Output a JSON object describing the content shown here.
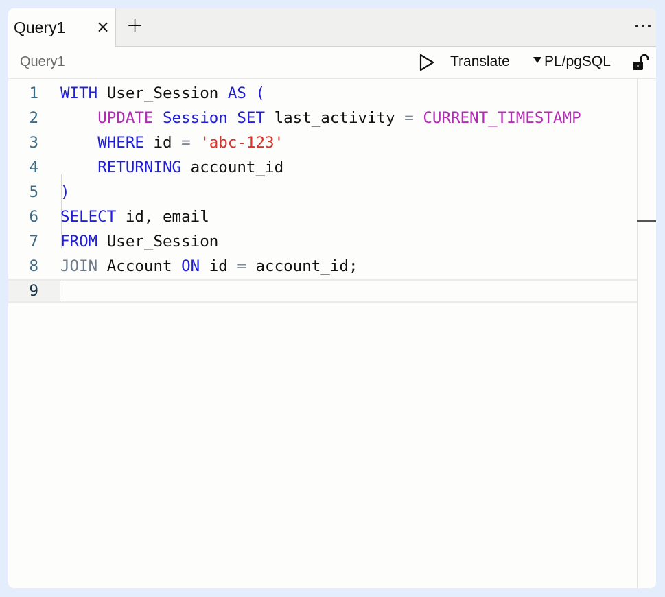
{
  "tabs": [
    {
      "label": "Query1",
      "active": true,
      "close_glyph": "×"
    }
  ],
  "tab_add_glyph": "+",
  "breadcrumb": "Query1",
  "toolbar": {
    "translate_label": "Translate",
    "language": "PL/pgSQL"
  },
  "icons": {
    "run": "play-icon",
    "more": "more-horizontal-icon",
    "lock": "unlock-icon",
    "dropdown": "caret-down-icon"
  },
  "colors": {
    "background": "#e3edfb",
    "keyword_blue": "#1f1fd8",
    "keyword_purple": "#b42bb5",
    "keyword_gray": "#6e7b8c",
    "string_red": "#d8322a",
    "line_number": "#3d6b85"
  },
  "editor": {
    "active_line": 9,
    "lines": [
      {
        "n": "1",
        "tokens": [
          {
            "t": "WITH",
            "c": "kw-blue"
          },
          {
            "t": " User_Session ",
            "c": "plain"
          },
          {
            "t": "AS",
            "c": "kw-blue"
          },
          {
            "t": " (",
            "c": "kw-blue"
          }
        ]
      },
      {
        "n": "2",
        "tokens": [
          {
            "t": "    ",
            "c": "plain"
          },
          {
            "t": "UPDATE",
            "c": "kw-purple"
          },
          {
            "t": " ",
            "c": "plain"
          },
          {
            "t": "Session",
            "c": "kw-blue"
          },
          {
            "t": " ",
            "c": "plain"
          },
          {
            "t": "SET",
            "c": "kw-blue"
          },
          {
            "t": " last_activity ",
            "c": "plain"
          },
          {
            "t": "=",
            "c": "op"
          },
          {
            "t": " ",
            "c": "plain"
          },
          {
            "t": "CURRENT_TIMESTAMP",
            "c": "kw-purple"
          }
        ]
      },
      {
        "n": "3",
        "tokens": [
          {
            "t": "    ",
            "c": "plain"
          },
          {
            "t": "WHERE",
            "c": "kw-blue"
          },
          {
            "t": " id ",
            "c": "plain"
          },
          {
            "t": "=",
            "c": "op"
          },
          {
            "t": " ",
            "c": "plain"
          },
          {
            "t": "'abc-123'",
            "c": "str-red"
          }
        ]
      },
      {
        "n": "4",
        "tokens": [
          {
            "t": "    ",
            "c": "plain"
          },
          {
            "t": "RETURNING",
            "c": "kw-blue"
          },
          {
            "t": " account_id",
            "c": "plain"
          }
        ]
      },
      {
        "n": "5",
        "tokens": [
          {
            "t": ")",
            "c": "kw-blue"
          }
        ]
      },
      {
        "n": "6",
        "tokens": [
          {
            "t": "SELECT",
            "c": "kw-blue"
          },
          {
            "t": " id, email",
            "c": "plain"
          }
        ]
      },
      {
        "n": "7",
        "tokens": [
          {
            "t": "FROM",
            "c": "kw-blue"
          },
          {
            "t": " User_Session",
            "c": "plain"
          }
        ]
      },
      {
        "n": "8",
        "tokens": [
          {
            "t": "JOIN",
            "c": "kw-gray"
          },
          {
            "t": " Account ",
            "c": "plain"
          },
          {
            "t": "ON",
            "c": "kw-blue"
          },
          {
            "t": " id ",
            "c": "plain"
          },
          {
            "t": "=",
            "c": "op"
          },
          {
            "t": " account_id;",
            "c": "plain"
          }
        ]
      },
      {
        "n": "9",
        "tokens": []
      }
    ]
  }
}
